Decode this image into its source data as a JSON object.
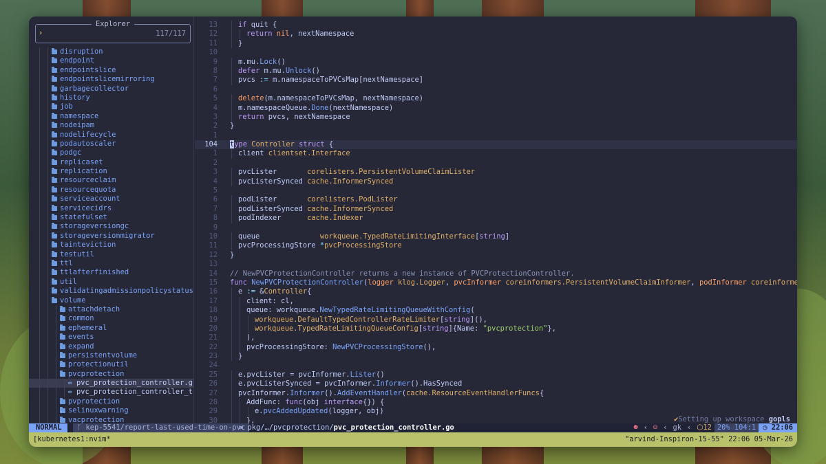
{
  "explorer": {
    "title": "Explorer",
    "prompt": "›",
    "count": "117/117",
    "items": [
      {
        "label": "disruption",
        "type": "folder",
        "depth": 2
      },
      {
        "label": "endpoint",
        "type": "folder",
        "depth": 2
      },
      {
        "label": "endpointslice",
        "type": "folder",
        "depth": 2
      },
      {
        "label": "endpointslicemirroring",
        "type": "folder",
        "depth": 2
      },
      {
        "label": "garbagecollector",
        "type": "folder",
        "depth": 2
      },
      {
        "label": "history",
        "type": "folder",
        "depth": 2
      },
      {
        "label": "job",
        "type": "folder",
        "depth": 2
      },
      {
        "label": "namespace",
        "type": "folder",
        "depth": 2
      },
      {
        "label": "nodeipam",
        "type": "folder",
        "depth": 2
      },
      {
        "label": "nodelifecycle",
        "type": "folder",
        "depth": 2
      },
      {
        "label": "podautoscaler",
        "type": "folder",
        "depth": 2
      },
      {
        "label": "podgc",
        "type": "folder",
        "depth": 2
      },
      {
        "label": "replicaset",
        "type": "folder",
        "depth": 2
      },
      {
        "label": "replication",
        "type": "folder",
        "depth": 2
      },
      {
        "label": "resourceclaim",
        "type": "folder",
        "depth": 2
      },
      {
        "label": "resourcequota",
        "type": "folder",
        "depth": 2
      },
      {
        "label": "serviceaccount",
        "type": "folder",
        "depth": 2
      },
      {
        "label": "servicecidrs",
        "type": "folder",
        "depth": 2
      },
      {
        "label": "statefulset",
        "type": "folder",
        "depth": 2
      },
      {
        "label": "storageversiongc",
        "type": "folder",
        "depth": 2
      },
      {
        "label": "storageversionmigrator",
        "type": "folder",
        "depth": 2
      },
      {
        "label": "tainteviction",
        "type": "folder",
        "depth": 2
      },
      {
        "label": "testutil",
        "type": "folder",
        "depth": 2
      },
      {
        "label": "ttl",
        "type": "folder",
        "depth": 2
      },
      {
        "label": "ttlafterfinished",
        "type": "folder",
        "depth": 2
      },
      {
        "label": "util",
        "type": "folder",
        "depth": 2
      },
      {
        "label": "validatingadmissionpolicystatus",
        "type": "folder",
        "depth": 2
      },
      {
        "label": "volume",
        "type": "folder",
        "depth": 2
      },
      {
        "label": "attachdetach",
        "type": "folder",
        "depth": 3
      },
      {
        "label": "common",
        "type": "folder",
        "depth": 3
      },
      {
        "label": "ephemeral",
        "type": "folder",
        "depth": 3
      },
      {
        "label": "events",
        "type": "folder",
        "depth": 3
      },
      {
        "label": "expand",
        "type": "folder",
        "depth": 3
      },
      {
        "label": "persistentvolume",
        "type": "folder",
        "depth": 3
      },
      {
        "label": "protectionutil",
        "type": "folder",
        "depth": 3
      },
      {
        "label": "pvcprotection",
        "type": "folder",
        "depth": 3
      },
      {
        "label": "pvc_protection_controller.g",
        "type": "file",
        "depth": 4,
        "selected": true
      },
      {
        "label": "pvc_protection_controller_t",
        "type": "file",
        "depth": 4
      },
      {
        "label": "pvprotection",
        "type": "folder",
        "depth": 3
      },
      {
        "label": "selinuxwarning",
        "type": "folder",
        "depth": 3
      },
      {
        "label": "vacprotection",
        "type": "folder",
        "depth": 3
      }
    ]
  },
  "editor": {
    "lines": [
      {
        "n": "13",
        "indent": 1,
        "tokens": [
          [
            "k",
            "if "
          ],
          [
            "v",
            "quit {"
          ]
        ]
      },
      {
        "n": "12",
        "indent": 2,
        "tokens": [
          [
            "k",
            "return "
          ],
          [
            "r",
            "nil"
          ],
          [
            "v",
            ", nextNamespace"
          ]
        ]
      },
      {
        "n": "11",
        "indent": 1,
        "tokens": [
          [
            "v",
            "}"
          ]
        ]
      },
      {
        "n": "10",
        "indent": 0,
        "tokens": []
      },
      {
        "n": "9",
        "indent": 1,
        "tokens": [
          [
            "v",
            "m.mu."
          ],
          [
            "f",
            "Lock"
          ],
          [
            "v",
            "()"
          ]
        ]
      },
      {
        "n": "8",
        "indent": 1,
        "tokens": [
          [
            "k",
            "defer "
          ],
          [
            "v",
            "m.mu."
          ],
          [
            "f",
            "Unlock"
          ],
          [
            "v",
            "()"
          ]
        ]
      },
      {
        "n": "7",
        "indent": 1,
        "tokens": [
          [
            "v",
            "pvcs "
          ],
          [
            "p",
            ":="
          ],
          [
            "v",
            " m.namespaceToPVCsMap[nextNamespace]"
          ]
        ]
      },
      {
        "n": "6",
        "indent": 0,
        "tokens": []
      },
      {
        "n": "5",
        "indent": 1,
        "tokens": [
          [
            "r",
            "delete"
          ],
          [
            "v",
            "(m.namespaceToPVCsMap, nextNamespace)"
          ]
        ]
      },
      {
        "n": "4",
        "indent": 1,
        "tokens": [
          [
            "v",
            "m.namespaceQueue."
          ],
          [
            "f",
            "Done"
          ],
          [
            "v",
            "(nextNamespace)"
          ]
        ]
      },
      {
        "n": "3",
        "indent": 1,
        "tokens": [
          [
            "k",
            "return "
          ],
          [
            "v",
            "pvcs, nextNamespace"
          ]
        ]
      },
      {
        "n": "2",
        "indent": 0,
        "tokens": [
          [
            "v",
            "}"
          ]
        ]
      },
      {
        "n": "1",
        "indent": 0,
        "tokens": []
      },
      {
        "n": "104",
        "indent": 0,
        "current": true,
        "cursor": "t",
        "tokens": [
          [
            "k",
            "ype "
          ],
          [
            "t",
            "Controller "
          ],
          [
            "k",
            "struct "
          ],
          [
            "v",
            "{"
          ]
        ]
      },
      {
        "n": "1",
        "indent": 1,
        "tokens": [
          [
            "v",
            "client "
          ],
          [
            "t",
            "clientset.Interface"
          ]
        ]
      },
      {
        "n": "2",
        "indent": 0,
        "tokens": []
      },
      {
        "n": "3",
        "indent": 1,
        "tokens": [
          [
            "v",
            "pvcLister       "
          ],
          [
            "t",
            "corelisters.PersistentVolumeClaimLister"
          ]
        ]
      },
      {
        "n": "4",
        "indent": 1,
        "tokens": [
          [
            "v",
            "pvcListerSynced "
          ],
          [
            "t",
            "cache.InformerSynced"
          ]
        ]
      },
      {
        "n": "5",
        "indent": 0,
        "tokens": []
      },
      {
        "n": "6",
        "indent": 1,
        "tokens": [
          [
            "v",
            "podLister       "
          ],
          [
            "t",
            "corelisters.PodLister"
          ]
        ]
      },
      {
        "n": "7",
        "indent": 1,
        "tokens": [
          [
            "v",
            "podListerSynced "
          ],
          [
            "t",
            "cache.InformerSynced"
          ]
        ]
      },
      {
        "n": "8",
        "indent": 1,
        "tokens": [
          [
            "v",
            "podIndexer      "
          ],
          [
            "t",
            "cache.Indexer"
          ]
        ]
      },
      {
        "n": "9",
        "indent": 0,
        "tokens": []
      },
      {
        "n": "10",
        "indent": 1,
        "tokens": [
          [
            "v",
            "queue              "
          ],
          [
            "t",
            "workqueue.TypedRateLimitingInterface"
          ],
          [
            "v",
            "["
          ],
          [
            "k",
            "string"
          ],
          [
            "v",
            "]"
          ]
        ]
      },
      {
        "n": "11",
        "indent": 1,
        "tokens": [
          [
            "v",
            "pvcProcessingStore "
          ],
          [
            "p",
            "*"
          ],
          [
            "t",
            "pvcProcessingStore"
          ]
        ]
      },
      {
        "n": "12",
        "indent": 0,
        "tokens": [
          [
            "v",
            "}"
          ]
        ]
      },
      {
        "n": "13",
        "indent": 0,
        "tokens": []
      },
      {
        "n": "14",
        "indent": 0,
        "tokens": [
          [
            "c",
            "// NewPVCProtectionController returns a new instance of PVCProtectionController."
          ]
        ]
      },
      {
        "n": "15",
        "indent": 0,
        "tokens": [
          [
            "k",
            "func "
          ],
          [
            "f",
            "NewPVCProtectionController"
          ],
          [
            "v",
            "("
          ],
          [
            "r",
            "logger "
          ],
          [
            "t",
            "klog.Logger"
          ],
          [
            "v",
            ", "
          ],
          [
            "r",
            "pvcInformer "
          ],
          [
            "t",
            "coreinformers.PersistentVolumeClaimInformer"
          ],
          [
            "v",
            ", "
          ],
          [
            "r",
            "podInformer "
          ],
          [
            "t",
            "coreinformers.PodInf"
          ]
        ]
      },
      {
        "n": "16",
        "indent": 1,
        "tokens": [
          [
            "v",
            "e "
          ],
          [
            "p",
            ":="
          ],
          [
            "v",
            " &"
          ],
          [
            "t",
            "Controller"
          ],
          [
            "v",
            "{"
          ]
        ]
      },
      {
        "n": "17",
        "indent": 2,
        "tokens": [
          [
            "v",
            "client: cl,"
          ]
        ]
      },
      {
        "n": "18",
        "indent": 2,
        "tokens": [
          [
            "v",
            "queue: workqueue."
          ],
          [
            "f",
            "NewTypedRateLimitingQueueWithConfig"
          ],
          [
            "v",
            "("
          ]
        ]
      },
      {
        "n": "19",
        "indent": 3,
        "tokens": [
          [
            "t",
            "workqueue.DefaultTypedControllerRateLimiter"
          ],
          [
            "v",
            "["
          ],
          [
            "k",
            "string"
          ],
          [
            "v",
            "](),"
          ]
        ]
      },
      {
        "n": "20",
        "indent": 3,
        "tokens": [
          [
            "t",
            "workqueue.TypedRateLimitingQueueConfig"
          ],
          [
            "v",
            "["
          ],
          [
            "k",
            "string"
          ],
          [
            "v",
            "]{Name: "
          ],
          [
            "s",
            "\"pvcprotection\""
          ],
          [
            "v",
            "},"
          ]
        ]
      },
      {
        "n": "21",
        "indent": 2,
        "tokens": [
          [
            "v",
            "),"
          ]
        ]
      },
      {
        "n": "22",
        "indent": 2,
        "tokens": [
          [
            "v",
            "pvcProcessingStore: "
          ],
          [
            "f",
            "NewPVCProcessingStore"
          ],
          [
            "v",
            "(),"
          ]
        ]
      },
      {
        "n": "23",
        "indent": 1,
        "tokens": [
          [
            "v",
            "}"
          ]
        ]
      },
      {
        "n": "24",
        "indent": 0,
        "tokens": []
      },
      {
        "n": "25",
        "indent": 1,
        "tokens": [
          [
            "v",
            "e.pvcLister = pvcInformer."
          ],
          [
            "f",
            "Lister"
          ],
          [
            "v",
            "()"
          ]
        ]
      },
      {
        "n": "26",
        "indent": 1,
        "tokens": [
          [
            "v",
            "e.pvcListerSynced = pvcInformer."
          ],
          [
            "f",
            "Informer"
          ],
          [
            "v",
            "().HasSynced"
          ]
        ]
      },
      {
        "n": "27",
        "indent": 1,
        "tokens": [
          [
            "v",
            "pvcInformer."
          ],
          [
            "f",
            "Informer"
          ],
          [
            "v",
            "()."
          ],
          [
            "f",
            "AddEventHandler"
          ],
          [
            "v",
            "("
          ],
          [
            "t",
            "cache.ResourceEventHandlerFuncs"
          ],
          [
            "v",
            "{"
          ]
        ]
      },
      {
        "n": "28",
        "indent": 2,
        "tokens": [
          [
            "v",
            "AddFunc: "
          ],
          [
            "k",
            "func"
          ],
          [
            "v",
            "(obj "
          ],
          [
            "k",
            "interface"
          ],
          [
            "v",
            "{}) {"
          ]
        ]
      },
      {
        "n": "29",
        "indent": 3,
        "tokens": [
          [
            "v",
            "e."
          ],
          [
            "f",
            "pvcAddedUpdated"
          ],
          [
            "v",
            "(logger, obj)"
          ]
        ]
      },
      {
        "n": "30",
        "indent": 2,
        "tokens": [
          [
            "v",
            "},"
          ]
        ]
      }
    ]
  },
  "statusline": {
    "mode": "NORMAL",
    "branch": "kep-5541/report-last-used-time-on-pvc",
    "path_prefix": "pkg/…/pvcprotection/",
    "filename": "pvc_protection_controller.go",
    "lsp_status": "Setting up workspace",
    "lsp_name": "gopls",
    "user": "gk",
    "errors": "12",
    "position": "20%  104:1",
    "time": "22:06"
  },
  "tmux": {
    "session": "[kubernetes1:nvim*",
    "host_info": "\"arvind-Inspiron-15-55\" 22:06 05-Mar-26"
  }
}
